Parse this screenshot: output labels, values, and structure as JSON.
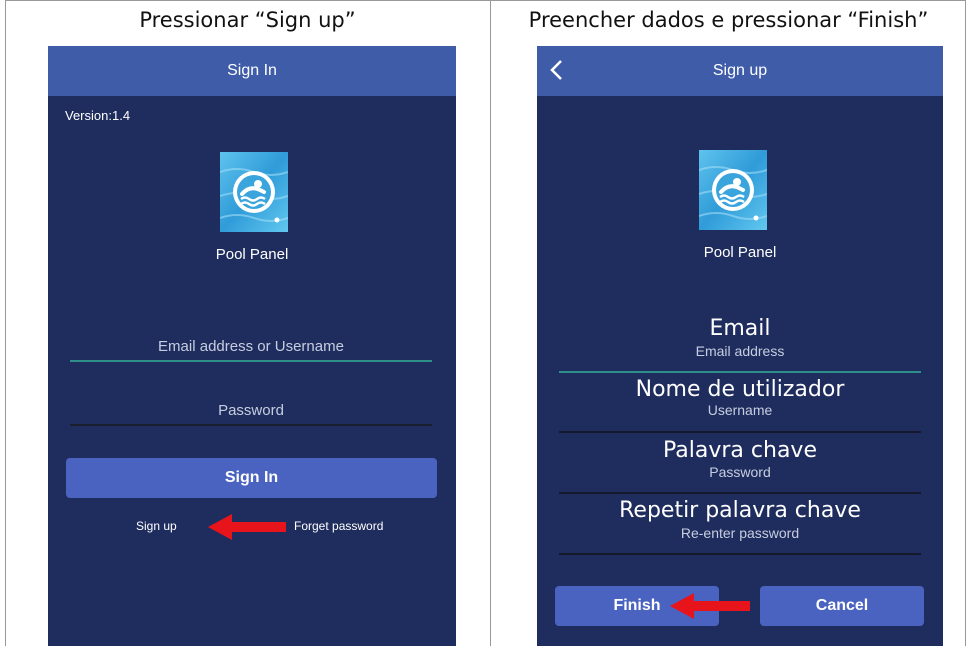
{
  "captions": {
    "left": "Pressionar “Sign up”",
    "right": "Preencher dados e pressionar “Finish”"
  },
  "signin": {
    "title": "Sign In",
    "version": "Version:1.4",
    "app_name": "Pool Panel",
    "email_placeholder": "Email address or Username",
    "password_placeholder": "Password",
    "signin_button": "Sign In",
    "signup_link": "Sign up",
    "forget_link": "Forget password"
  },
  "signup": {
    "title": "Sign up",
    "app_name": "Pool Panel",
    "fields": [
      {
        "label": "Email",
        "placeholder": "Email address"
      },
      {
        "label": "Nome de utilizador",
        "placeholder": "Username"
      },
      {
        "label": "Palavra chave",
        "placeholder": "Password"
      },
      {
        "label": "Repetir palavra chave",
        "placeholder": "Re-enter password"
      }
    ],
    "finish_button": "Finish",
    "cancel_button": "Cancel"
  },
  "colors": {
    "background": "#1f2d5e",
    "appbar": "#3f5ca9",
    "button": "#4a63c0",
    "arrow": "#e8141b",
    "active_underline": "#2e8f8a"
  },
  "icons": [
    "swimmer-logo-icon",
    "back-arrow-icon",
    "red-arrow-icon"
  ]
}
